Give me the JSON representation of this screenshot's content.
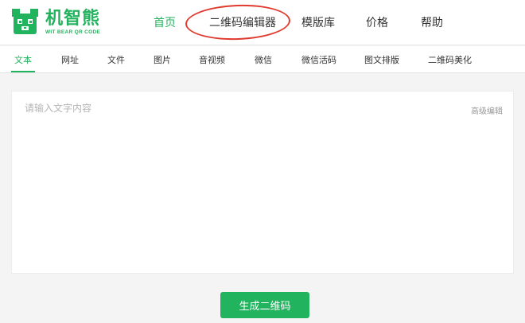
{
  "brand": {
    "name": "机智熊",
    "tagline": "WIT BEAR QR CODE",
    "color": "#22b35e"
  },
  "nav": {
    "items": [
      {
        "label": "首页",
        "active": true
      },
      {
        "label": "二维码编辑器",
        "active": false
      },
      {
        "label": "模版库",
        "active": false
      },
      {
        "label": "价格",
        "active": false
      },
      {
        "label": "帮助",
        "active": false
      }
    ]
  },
  "tabs": [
    {
      "label": "文本",
      "active": true
    },
    {
      "label": "网址",
      "active": false
    },
    {
      "label": "文件",
      "active": false
    },
    {
      "label": "图片",
      "active": false
    },
    {
      "label": "音视频",
      "active": false
    },
    {
      "label": "微信",
      "active": false
    },
    {
      "label": "微信活码",
      "active": false
    },
    {
      "label": "图文排版",
      "active": false
    },
    {
      "label": "二维码美化",
      "active": false
    }
  ],
  "editor": {
    "placeholder": "请输入文字内容",
    "value": "",
    "advanced_label": "高级编辑"
  },
  "actions": {
    "generate_label": "生成二维码"
  },
  "annotation": {
    "color": "#e03a2f"
  }
}
